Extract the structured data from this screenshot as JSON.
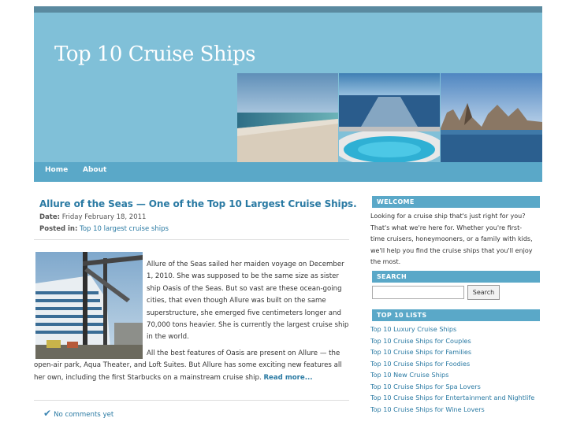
{
  "site": {
    "title": "Top 10 Cruise Ships"
  },
  "nav": {
    "items": [
      {
        "label": "Home"
      },
      {
        "label": "About"
      }
    ]
  },
  "post": {
    "title": "Allure of the Seas — One of the Top 10 Largest Cruise Ships.",
    "date_label": "Date:",
    "date_value": "Friday February 18, 2011",
    "posted_label": "Posted in:",
    "category": "Top 10 largest cruise ships",
    "body_lines_1": [
      "Allure of the Seas sailed her maiden voyage on December",
      "1, 2010. She was supposed to be the same size as sister",
      "ship Oasis of the Seas. But so vast are these ocean-going",
      "cities, that even though Allure was built on the same",
      "superstructure, she emerged five centimeters longer and",
      "70,000 tons heavier. She is currently the largest cruise ship",
      "in the world."
    ],
    "body_lines_2": [
      "All the best features of Oasis are present on Allure — the",
      "open-air park, Aqua Theater, and Loft Suites. But Allure has some exciting new features all",
      "her own, including the first Starbucks on a mainstream cruise ship."
    ],
    "read_more": "Read more...",
    "comments": "No comments yet"
  },
  "sidebar": {
    "welcome": {
      "title": "WELCOME",
      "lines": [
        "Looking for a cruise ship that's just right for you?",
        "That's what we're here for. Whether you're first-",
        "time cruisers, honeymooners, or a family with kids,",
        "we'll help you find the cruise ships that you'll enjoy",
        "the most."
      ]
    },
    "search": {
      "title": "SEARCH",
      "input_value": "",
      "button_label": "Search"
    },
    "lists": {
      "title": "TOP 10 LISTS",
      "items": [
        "Top 10 Luxury Cruise Ships",
        "Top 10 Cruise Ships for Couples",
        "Top 10 Cruise Ships for Families",
        "Top 10 Cruise Ships for Foodies",
        "Top 10 New Cruise Ships",
        "Top 10 Cruise Ships for Spa Lovers",
        "Top 10 Cruise Ships for Entertainment and Nightlife",
        "Top 10 Cruise Ships for Wine Lovers"
      ]
    }
  },
  "colors": {
    "header_bg": "#80c0d8",
    "nav_bg": "#5aa8c8",
    "link": "#2a7aa3",
    "topbar": "#5a8aa0"
  },
  "icons": {
    "comments": "checkmark-icon"
  }
}
